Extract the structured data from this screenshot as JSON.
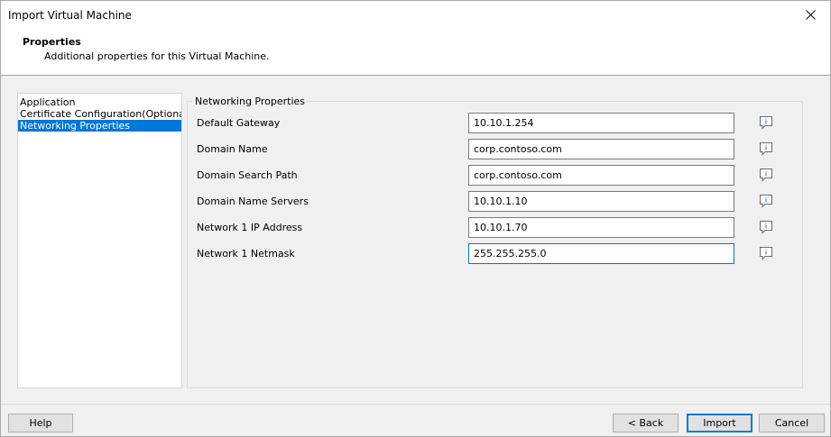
{
  "window": {
    "title": "Import Virtual Machine"
  },
  "header": {
    "title": "Properties",
    "subtitle": "Additional properties for this Virtual Machine."
  },
  "nav": {
    "items": [
      {
        "label": "Application"
      },
      {
        "label": "Certificate Configuration(Optional)"
      },
      {
        "label": "Networking Properties"
      }
    ],
    "selected": "Networking Properties"
  },
  "group": {
    "label": "Networking Properties",
    "fields": [
      {
        "label": "Default Gateway",
        "value": "10.10.1.254"
      },
      {
        "label": "Domain Name",
        "value": "corp.contoso.com"
      },
      {
        "label": "Domain Search Path",
        "value": "corp.contoso.com"
      },
      {
        "label": "Domain Name Servers",
        "value": "10.10.1.10"
      },
      {
        "label": "Network 1 IP Address",
        "value": "10.10.1.70"
      },
      {
        "label": "Network 1 Netmask",
        "value": "255.255.255.0"
      }
    ]
  },
  "footer": {
    "help_label": "Help",
    "back_label": "< Back",
    "import_label": "Import",
    "cancel_label": "Cancel"
  },
  "icons": {
    "close": "close-icon",
    "info": "info-icon"
  },
  "colors": {
    "selection": "#0078d7",
    "focus_border": "#0078d7"
  }
}
